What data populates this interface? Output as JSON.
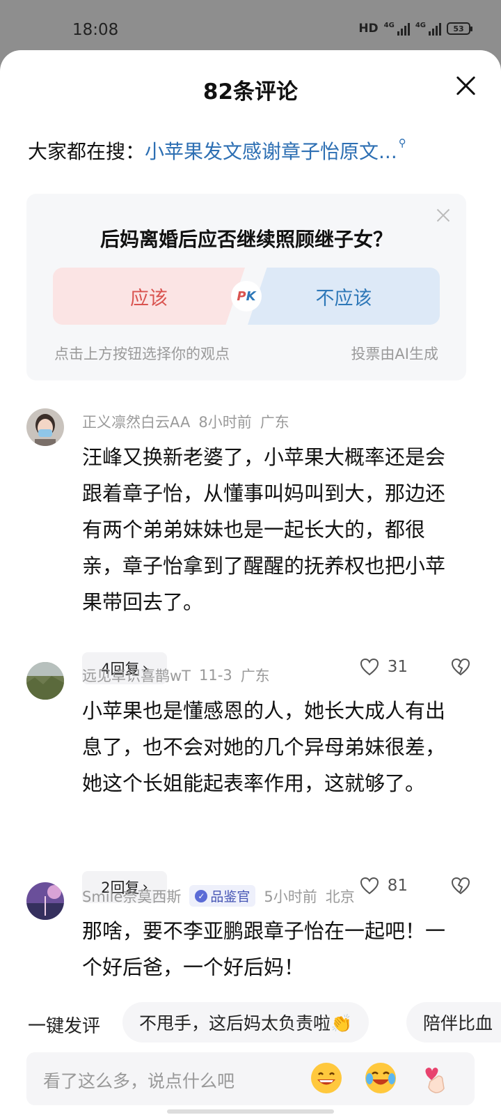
{
  "status": {
    "time": "18:08",
    "hd": "HD",
    "sim1": "4G",
    "sim2": "4G",
    "battery": "53"
  },
  "header": {
    "title": "82条评论"
  },
  "hot_search": {
    "prefix": "大家都在搜：",
    "query": "小苹果发文感谢章子怡原文..."
  },
  "poll": {
    "question": "后妈离婚后应否继续照顾继子女？",
    "option_yes": "应该",
    "option_no": "不应该",
    "pk_p": "P",
    "pk_k": "K",
    "hint": "点击上方按钮选择你的观点",
    "ai_note": "投票由AI生成"
  },
  "comments": [
    {
      "user": "正义凛然白云AA",
      "time": "8小时前",
      "location": "广东",
      "text": "汪峰又换新老婆了，小苹果大概率还是会跟着章子怡，从懂事叫妈叫到大，那边还有两个弟弟妹妹也是一起长大的，都很亲，章子怡拿到了醒醒的抚养权也把小苹果带回去了。",
      "replies": "4回复",
      "likes": "31"
    },
    {
      "user": "远见卓识喜鹊wT",
      "time": "11-3",
      "location": "广东",
      "text": "小苹果也是懂感恩的人，她长大成人有出息了，也不会对她的几个异母弟妹很差，她这个长姐能起表率作用，这就够了。",
      "replies": "2回复",
      "likes": "81"
    },
    {
      "user": "Smile奈莫西斯",
      "badge": "品鉴官",
      "time": "5小时前",
      "location": "北京",
      "text": "那啥，要不李亚鹏跟章子怡在一起吧！一个好后爸，一个好后妈！"
    }
  ],
  "quick_comment": {
    "label": "一键发评",
    "chip1": "不甩手，这后妈太负责啦👏",
    "chip2": "陪伴比血"
  },
  "input": {
    "placeholder": "看了这么多，说点什么吧"
  },
  "colors": {
    "accent_blue": "#2d6fb3",
    "pk_red": "#d9534f",
    "pk_blue": "#2e78b8"
  }
}
